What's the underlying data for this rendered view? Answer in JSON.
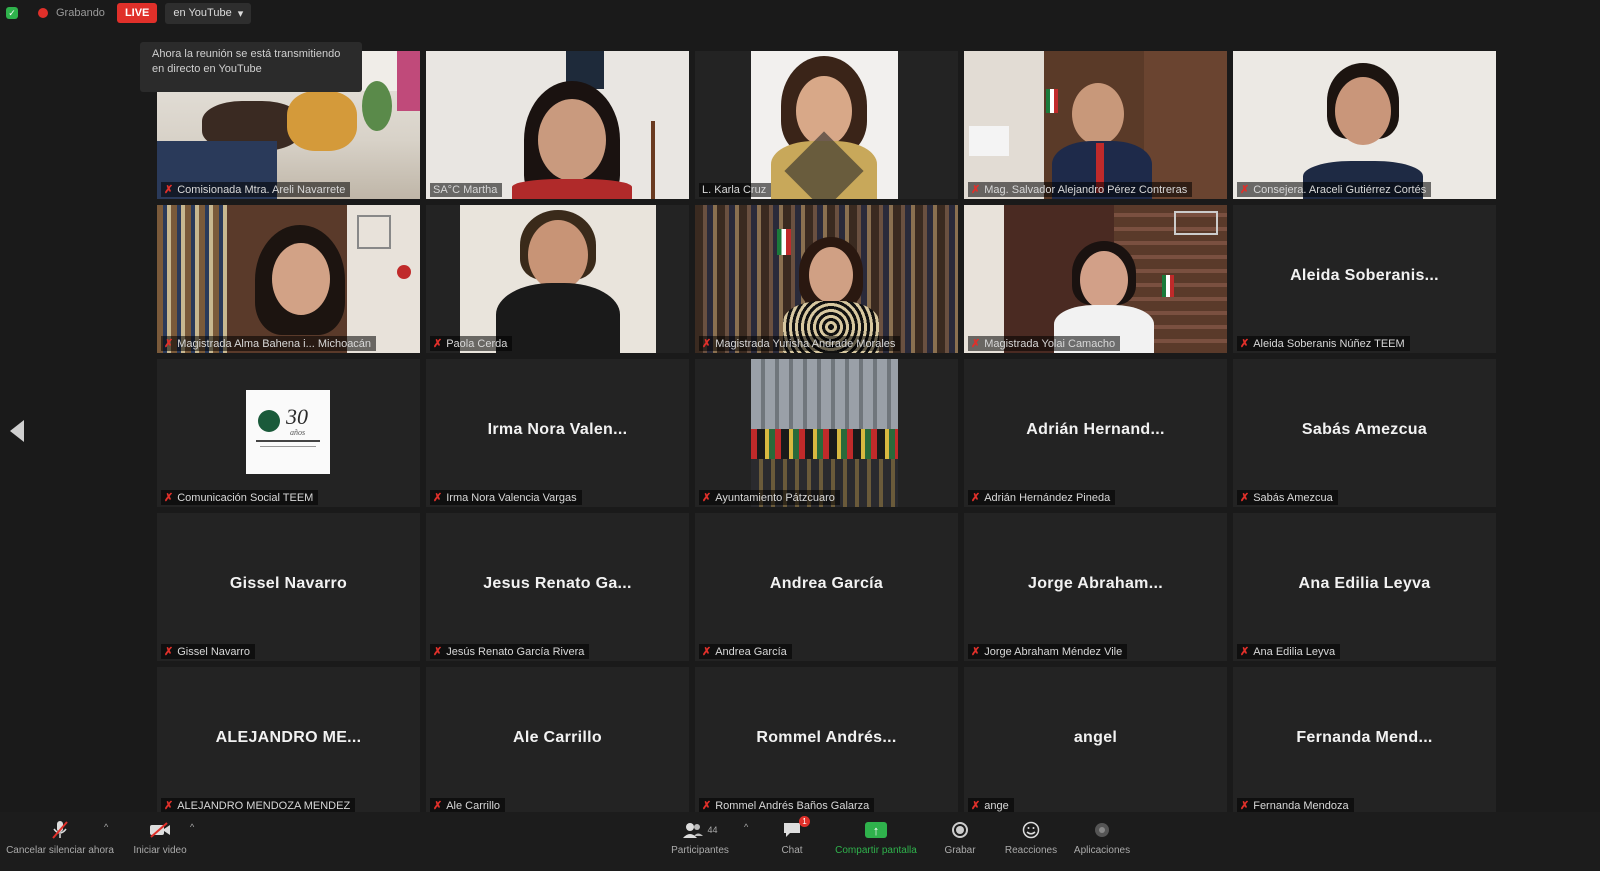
{
  "topbar": {
    "recording_label": "Grabando",
    "live_label": "LIVE",
    "stream_target": "en YouTube"
  },
  "tooltip": {
    "line1": "Ahora la reunión se está transmitiendo",
    "line2": "en directo en YouTube"
  },
  "tiles": [
    {
      "label": "Comisionada Mtra. Areli Navarrete",
      "big": ""
    },
    {
      "label": "SA°C Martha",
      "big": ""
    },
    {
      "label": "L. Karla Cruz",
      "big": ""
    },
    {
      "label": "Mag. Salvador Alejandro Pérez Contreras",
      "big": ""
    },
    {
      "label": "Consejera. Araceli Gutiérrez Cortés",
      "big": ""
    },
    {
      "label": "Magistrada Alma Bahena i... Michoacán",
      "big": ""
    },
    {
      "label": "Paola Cerda",
      "big": ""
    },
    {
      "label": "Magistrada Yurisha Andrade Morales",
      "big": ""
    },
    {
      "label": "Magistrada Yolai Camacho",
      "big": ""
    },
    {
      "label": "Aleida Soberanis Núñez TEEM",
      "big": "Aleida Soberanis..."
    },
    {
      "label": "Comunicación Social TEEM",
      "big": ""
    },
    {
      "label": "Irma Nora Valencia Vargas",
      "big": "Irma Nora Valen..."
    },
    {
      "label": "Ayuntamiento Pátzcuaro",
      "big": ""
    },
    {
      "label": "Adrián Hernández Pineda",
      "big": "Adrián Hernand..."
    },
    {
      "label": "Sabás Amezcua",
      "big": "Sabás Amezcua"
    },
    {
      "label": "Gissel Navarro",
      "big": "Gissel Navarro"
    },
    {
      "label": "Jesús Renato García Rivera",
      "big": "Jesus Renato Ga..."
    },
    {
      "label": "Andrea García",
      "big": "Andrea García"
    },
    {
      "label": "Jorge Abraham Méndez Vile",
      "big": "Jorge Abraham..."
    },
    {
      "label": "Ana Edilia Leyva",
      "big": "Ana Edilia Leyva"
    },
    {
      "label": "ALEJANDRO MENDOZA MENDEZ",
      "big": "ALEJANDRO ME..."
    },
    {
      "label": "Ale Carrillo",
      "big": "Ale Carrillo"
    },
    {
      "label": "Rommel Andrés Baños Galarza",
      "big": "Rommel Andrés..."
    },
    {
      "label": "ange",
      "big": "angel"
    },
    {
      "label": "Fernanda Mendoza",
      "big": "Fernanda Mend..."
    }
  ],
  "logo_tile": {
    "number": "30",
    "subtitle": "años"
  },
  "toolbar": {
    "unmute": "Cancelar silenciar ahora",
    "video": "Iniciar video",
    "participants": "Participantes",
    "participants_count": "44",
    "chat": "Chat",
    "chat_badge": "1",
    "share": "Compartir pantalla",
    "record": "Grabar",
    "reactions": "Reacciones",
    "apps": "Aplicaciones"
  }
}
